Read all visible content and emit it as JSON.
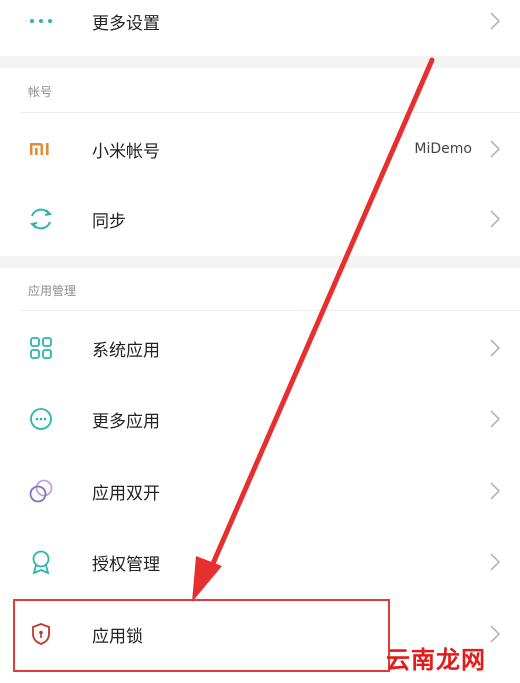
{
  "rows": {
    "more_settings": {
      "label": "更多设置",
      "icon": "more-dots-icon"
    },
    "mi_account": {
      "label": "小米帐号",
      "value": "MiDemo",
      "icon": "mi-logo-icon"
    },
    "sync": {
      "label": "同步",
      "icon": "sync-icon"
    },
    "system_apps": {
      "label": "系统应用",
      "icon": "grid-icon"
    },
    "more_apps": {
      "label": "更多应用",
      "icon": "more-circle-icon"
    },
    "dual_apps": {
      "label": "应用双开",
      "icon": "dual-circle-icon"
    },
    "permissions": {
      "label": "授权管理",
      "icon": "badge-icon"
    },
    "app_lock": {
      "label": "应用锁",
      "icon": "shield-lock-icon"
    }
  },
  "sections": {
    "account": "帐号",
    "app_management": "应用管理"
  },
  "watermark": "云南龙网",
  "colors": {
    "accent": "#2bb5b0",
    "mi_orange": "#e8883a",
    "highlight_red": "#e23a3a",
    "arrow_red": "#e5302f"
  }
}
